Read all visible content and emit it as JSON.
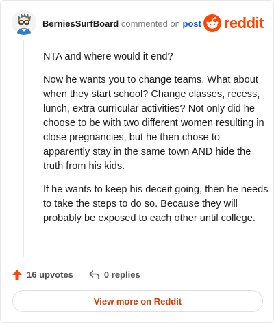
{
  "comment": {
    "username": "BerniesSurfBoard",
    "action_text": "commented on",
    "link_text": "post",
    "paragraphs": [
      "NTA and where would it end?",
      "Now he wants you to change teams. What about when they start school? Change classes, recess, lunch, extra curricular activities? Not only did he choose to be with two different women resulting in close pregnancies, but he then chose to apparently stay in the same town AND hide the truth from his kids.",
      "If he wants to keep his deceit going, then he needs to take the steps to do so. Because they will probably be exposed to each other until college."
    ]
  },
  "brand": {
    "wordmark": "reddit",
    "color": "#ff4500"
  },
  "stats": {
    "upvotes_label": "16 upvotes",
    "replies_label": "0 replies"
  },
  "footer": {
    "view_more_label": "View more on Reddit"
  },
  "icons": {
    "upvote": "upvote-arrow-icon",
    "reply": "reply-arrow-icon",
    "brand": "reddit-snoo-icon",
    "avatar": "user-avatar"
  }
}
